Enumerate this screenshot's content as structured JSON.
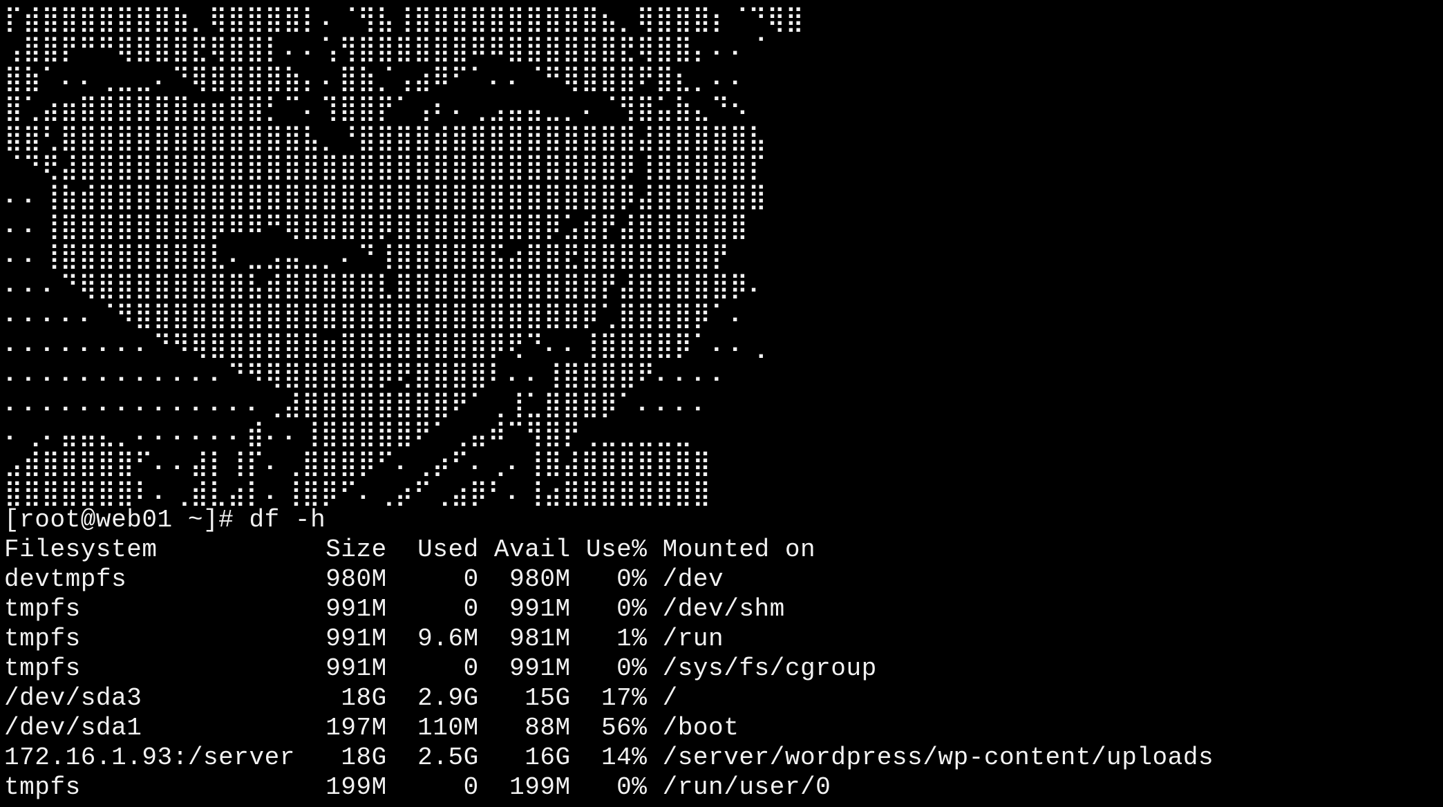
{
  "terminal": {
    "background_color": "#000000",
    "text_color": "#f2f2f2",
    "banner_lines": [
      "⡏⣾⣿⣿⣿⣿⣿⣿⣿⣷⡀⢿⣿⣿⣿⣿⡇⠄⠈⢻⣧⢸⣿⣿⣿⣿⣿⣿⣿⣿⣿⣿⣦⡀⢿⣿⣿⣿⡆⠈⠙⢿⣿",
      "⢠⣿⣿⡟⠛⠛⢿⣿⣿⣿⣟⢿⣿⣿⡇⠄⠄⢡⢻⣿⣿⣿⣿⣿⣿⠿⠿⣿⣿⣿⣿⣿⣿⣟⢿⣿⣿⡄⠄⠄⠈",
      "⣿⣷⠁⠄⠄⢀⣀⣀⠄⠙⢿⣿⣿⣿⣿⣷⡄⠄⣿⣷⡈⢠⣴⠿⠋⠁⠄⠄⠈⠛⢿⣿⣿⣿⠟⣿⣆⡀⠄⠄",
      "⣿⢁⣴⣶⣿⣿⣿⣿⣿⣿⣶⣶⣿⣿⡃⠉⠄⢹⣿⣿⡟⠁⢠⠆⠄⢀⣠⣤⣤⣀⡀⠄⠈⢻⣿⣥⣷⣄⠙⠢",
      "⣿⣿⢃⣿⣿⣿⣿⣿⣿⣿⣿⣿⣿⣿⣿⣿⣧⡀⠘⣿⣿⣿⣿⣾⣿⣿⣿⣿⣿⣿⣿⣿⣿⣿⣼⣿⣿⣿⣿⣿⣧",
      "⠈⠙⢟⣼⣿⣿⣿⣿⣿⣿⣿⣿⣿⣿⣿⣿⣿⣿⣿⣿⣿⣿⣿⣿⣿⣿⣿⣿⣿⣿⣿⣿⣿⡿⢸⣿⣿⣿⣿⣿⡏",
      "⠄⠄⢸⣷⣾⣿⣿⣿⣿⣿⣿⣿⣿⣿⣿⣿⣿⣿⣿⣿⣿⣿⣿⣿⣿⣿⣿⣿⣿⣿⣿⣿⣿⡿⣼⣿⣿⣿⣿⣿⣿",
      "⠄⠄⢸⣿⣿⣿⣿⣿⣿⣿⣿⡿⠿⠿⠛⢿⣿⣿⣿⣿⡿⣿⣿⣿⣿⣿⣿⣿⣿⡿⣡⣾⡟⣼⣿⣿⣿⣿⣿⣿",
      "⠄⠄⢸⣿⣿⣿⣿⣿⣿⣿⣿⣇⠄⣀⣠⣤⣀⡀⠄⠙⢸⣿⣿⣿⣿⣿⣯⣴⣿⣿⣟⣿⣿⣿⣿⣿⣿⣿⡟",
      "⠄⠄⠄⠙⢿⣿⣿⣿⣿⣿⣿⣿⣿⣧⣾⣿⣿⣿⣿⣿⣇⣿⣿⣿⣿⣿⣿⣿⣿⣿⣿⣿⡟⣼⣿⣿⣿⣿⣿⡿⠄",
      "⠄⠄⠄⠄⠄⠈⠻⣿⣿⣿⣿⣿⣿⣿⣿⣿⣿⣿⣿⣿⣿⣿⣿⣿⣿⣿⣿⣿⣿⣿⣿⡿⢁⣿⣿⣿⣿⡿⠁⠄",
      "⠄⠄⠄⠄⠄⠄⠄⠄⠙⠻⢿⣿⣿⣿⣿⣿⣿⣶⣿⣿⣿⣿⣿⣿⣿⣿⡿⢟⠙⠄⠄⢸⣿⣿⣿⣿⡿⠁⠄⠄⢀",
      "⠄⠄⠄⠄⠄⠄⠄⠄⠄⠄⠄⠄⠙⠻⢿⣿⣿⣿⣿⣿⡿⢟⣿⣿⣿⣿⠇⠄⠄⢸⣿⣿⣿⣿⠟⠄⠄⠄⠄",
      "⠄⠄⠄⠄⠄⠄⠄⠄⠄⠄⠄⠄⠄⠄⢀⣼⣿⣿⣿⣿⣿⣿⣿⣿⠟⠁⢀⢸⣁⣿⣿⣿⡿⠁⠄⠄⠄⠄",
      "⠄⢀⠄⣤⣤⣄⡀⠄⠄⠄⠄⠄⠄⣾⠄⠄⢸⣿⣿⣿⣿⣿⠟⠁⢀⣤⠾⠉⢻⣿⡟⢀⣀⣀⣀⣀⣀",
      "⣠⣾⣿⣿⣿⣿⣿⠋⠄⠄⣼⡇⢸⡏⠄⢀⣿⣿⣿⡿⠋⠄⢀⡴⠋⠄⢀⠄⢸⣿⣼⣿⣿⣿⣿⣿⣿⣿",
      "⣿⣿⣿⣿⣿⣿⣿⠇⠄⢀⣾⣇⣴⡇⠄⢸⣿⡿⠋⠄⢀⡴⠋⢀⣴⡿⠃⠄⢸⣴⣿⣿⣿⣿⣿⣿⣿⣿"
    ],
    "session_lines": [
      "[root@web01 ~]# df -h",
      "Filesystem           Size  Used Avail Use% Mounted on",
      "devtmpfs             980M     0  980M   0% /dev",
      "tmpfs                991M     0  991M   0% /dev/shm",
      "tmpfs                991M  9.6M  981M   1% /run",
      "tmpfs                991M     0  991M   0% /sys/fs/cgroup",
      "/dev/sda3             18G  2.9G   15G  17% /",
      "/dev/sda1            197M  110M   88M  56% /boot",
      "172.16.1.93:/server   18G  2.5G   16G  14% /server/wordpress/wp-content/uploads",
      "tmpfs                199M     0  199M   0% /run/user/0"
    ]
  }
}
